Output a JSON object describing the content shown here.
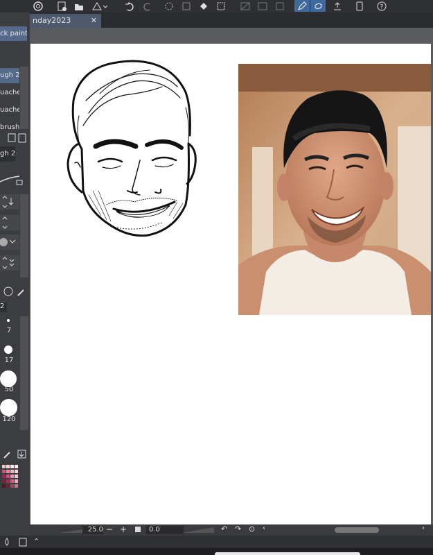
{
  "document": {
    "tab_title": "nday2023"
  },
  "sidebar": {
    "fill_button": "ck paint",
    "brushes": [
      "ugh 2",
      "uache",
      "uache",
      "brush"
    ],
    "subtool_label": "gh 2",
    "layer_number": "2",
    "brush_sizes": [
      "7",
      "17",
      "50",
      "120"
    ]
  },
  "bottom": {
    "zoom": "25.0",
    "angle": "0.0"
  },
  "colors": {
    "accent": "#3f6aa0",
    "panel": "#3c3d40",
    "canvas": "#ffffff",
    "swatches": [
      "#f4c6c6",
      "#f9d7d7",
      "#fde6e6",
      "#fff0f0",
      "#e34b6f",
      "#f0829c",
      "#f7adbf",
      "#fcd3dc",
      "#c2185b",
      "#e0457b",
      "#f48fb1",
      "#fbc3d4",
      "#8e1b3c",
      "#b32652",
      "#d95a7e",
      "#ecaab9",
      "#5a1026",
      "#7d1a37",
      "#a8405b",
      "#c97689"
    ]
  },
  "icons": [
    "new-canvas-icon",
    "open-folder-icon",
    "save-icon",
    "undo-icon",
    "redo-icon",
    "transform-icon",
    "fill-icon",
    "selection-icon",
    "pen-icon",
    "lasso-icon",
    "export-icon",
    "phone-icon",
    "help-icon"
  ]
}
